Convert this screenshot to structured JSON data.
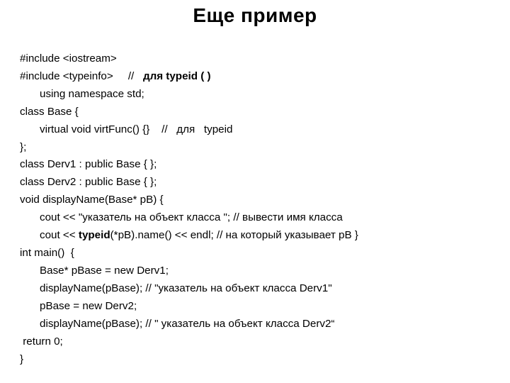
{
  "title": "Еще пример",
  "lines": {
    "l1a": "#include <iostream>",
    "l2a": "#include <typeinfo>     //   ",
    "l2b": "для typeid ( )",
    "l3": "using namespace std;",
    "l4": "class Base {",
    "l5": "virtual void virtFunc() {}    //   для   typeid",
    "l6": "};",
    "l7": "class Derv1 : public Base { };",
    "l8": "class Derv2 : public Base { };",
    "l9": "void displayName(Base* pB) {",
    "l10": "cout << \"указатель на объект класса \"; // вывести имя класса",
    "l11a": "cout << ",
    "l11b": "typeid",
    "l11c": "(*pB).name() << endl; // на который указывает pB }",
    "l12": "int main()  {",
    "l13": "Base* pBase = new Derv1;",
    "l14": "displayName(pBase); // \"указатель на объект класса Derv1\"",
    "l15": "pBase = new Derv2;",
    "l16": "displayName(pBase); // \" указатель на объект класса Derv2“",
    "l17": " return 0;",
    "l18": "}"
  }
}
